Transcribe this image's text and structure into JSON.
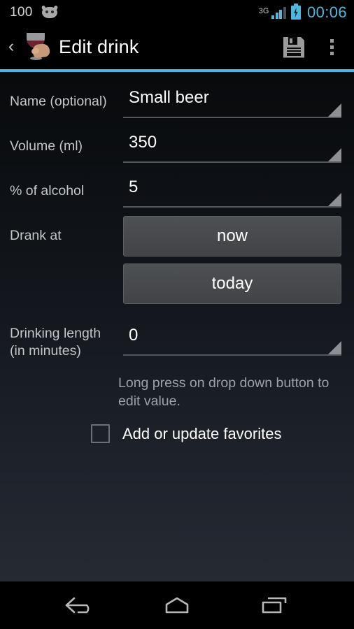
{
  "status_bar": {
    "battery_percent": "100",
    "android_icon": "android-head-icon",
    "network_type": "3G",
    "signal_icon": "signal-bars-icon",
    "battery_icon": "battery-charging-icon",
    "clock": "00:06",
    "accent_color": "#4fb6dd"
  },
  "action_bar": {
    "back_glyph": "‹",
    "app_icon": "wine-glass-icon",
    "title": "Edit drink",
    "save_icon": "floppy-disk-icon",
    "overflow_icon": "overflow-menu-icon",
    "divider_color": "#4fb6dd"
  },
  "form": {
    "fields": [
      {
        "label": "Name (optional)",
        "value": "Small beer"
      },
      {
        "label": "Volume (ml)",
        "value": "350"
      },
      {
        "label": "% of alcohol",
        "value": "5"
      }
    ],
    "drank_at": {
      "label": "Drank at",
      "time_button": "now",
      "date_button": "today"
    },
    "drinking_length": {
      "label_line1": "Drinking length",
      "label_line2": "(in minutes)",
      "value": "0"
    },
    "hint": "Long press on drop down button to edit value.",
    "favorites": {
      "label": "Add or update favorites",
      "checked": false
    }
  },
  "nav_bar": {
    "back_icon": "back-arrow-icon",
    "home_icon": "home-icon",
    "recents_icon": "recents-icon"
  }
}
